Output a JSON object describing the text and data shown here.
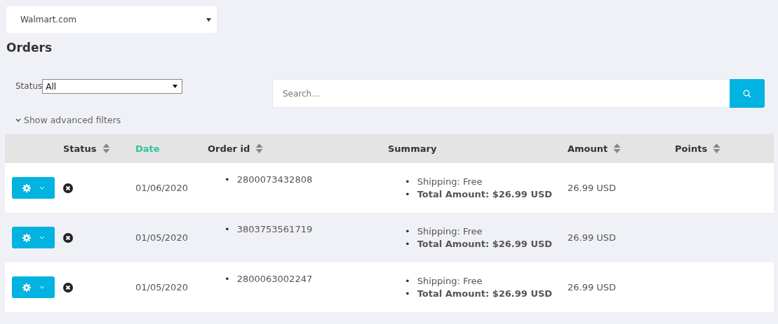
{
  "store_select": {
    "value": "Walmart.com"
  },
  "title": "Orders",
  "filters": {
    "status_label": "Status",
    "status_value": "All",
    "search_placeholder": "Search...",
    "advanced_toggle": "Show advanced filters",
    "advanced_expanded": false
  },
  "table": {
    "bullet": "•",
    "columns": [
      {
        "label": "Status",
        "sortable": true,
        "selected": false
      },
      {
        "label": "Date",
        "sortable": false,
        "selected": true
      },
      {
        "label": "Order id",
        "sortable": true,
        "selected": false
      },
      {
        "label": "Summary",
        "sortable": false,
        "selected": false
      },
      {
        "label": "Amount",
        "sortable": true,
        "selected": false
      },
      {
        "label": "Points",
        "sortable": true,
        "selected": false
      }
    ],
    "rows": [
      {
        "date": "01/06/2020",
        "order_ids": [
          "2800073432808"
        ],
        "summary": [
          "Shipping: Free",
          "**Total Amount: $26.99 USD**"
        ],
        "amount": "26.99 USD"
      },
      {
        "date": "01/05/2020",
        "order_ids": [
          "3803753561719"
        ],
        "summary": [
          "Shipping: Free",
          "**Total Amount: $26.99 USD**"
        ],
        "amount": "26.99 USD"
      },
      {
        "date": "01/05/2020",
        "order_ids": [
          "2800063002247"
        ],
        "summary": [
          "Shipping: Free",
          "**Total Amount: $26.99 USD**"
        ],
        "amount": "26.99 USD"
      }
    ]
  }
}
